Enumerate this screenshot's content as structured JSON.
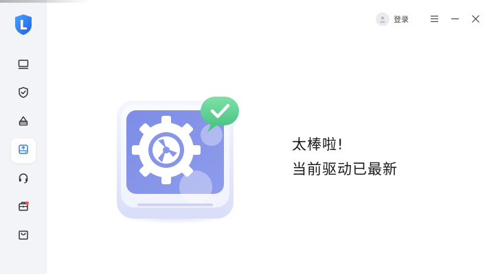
{
  "app": {
    "accent": "#2f7cf6",
    "logo_icon": "shield-logo-icon"
  },
  "sidebar": {
    "items": [
      {
        "name": "monitor",
        "icon": "monitor-icon",
        "active": false
      },
      {
        "name": "shield",
        "icon": "shield-check-icon",
        "active": false
      },
      {
        "name": "cleanup",
        "icon": "brush-icon",
        "active": false
      },
      {
        "name": "driver",
        "icon": "drive-icon",
        "active": true
      },
      {
        "name": "support",
        "icon": "headset-icon",
        "active": false
      },
      {
        "name": "toolbox",
        "icon": "toolbox-icon",
        "active": false,
        "badge": true
      },
      {
        "name": "store",
        "icon": "bag-icon",
        "active": false
      }
    ]
  },
  "titlebar": {
    "login_label": "登录"
  },
  "main": {
    "status_title": "太棒啦!",
    "status_message": "当前驱动已最新",
    "status_color": "#5fcf8f"
  }
}
